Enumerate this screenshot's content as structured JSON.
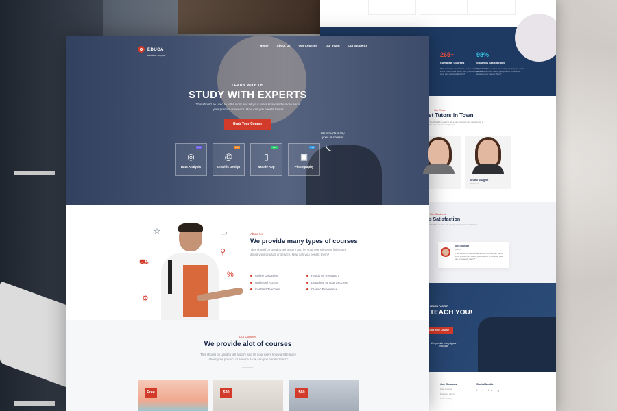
{
  "back_page": {
    "cards": [
      "",
      "",
      ""
    ],
    "stats": [
      {
        "value": "265+",
        "label": "Complete Courses",
        "text": "This should be used to tell a story and let your users know a little more about your product or service. How can you benefit them?",
        "color": "#f0513c"
      },
      {
        "value": "98%",
        "label": "Students Satisfaction",
        "text": "This should be used to tell a story and let your users know a little more about your product or service. How can you benefit them?",
        "color": "#38c4e8"
      }
    ],
    "tutors": {
      "tag": "Our Team",
      "heading": "st Tutors in Town",
      "text": "This should be used to tell a story and let your users know a little more about your product",
      "people": [
        {
          "name": "...nson",
          "role": ""
        },
        {
          "name": "Bruno Vaughn",
          "role": "Professor"
        }
      ]
    },
    "testimonial": {
      "tag": "Our Students",
      "heading": "nts Satisfaction",
      "text": "This should be used to tell a story and let your users know",
      "name": "Vera Duncan",
      "role": "Student",
      "quote": "“This should be used to tell a story and let your users know a little more about your product or service. How can you benefit them?”"
    },
    "cta": {
      "small": "LEARN FASTER",
      "big": "N TEACH YOU!",
      "button": "Grab Your Course",
      "note": "We provide many types of course"
    },
    "footer": {
      "col1_title": "Our Courses",
      "col1_items": [
        "Data Analysis",
        "Business Learn",
        "IT Consulting"
      ],
      "col2_title": "Social Media",
      "col2_icons": "f  t  in  g"
    }
  },
  "front_page": {
    "logo": {
      "name": "EDUCA",
      "sub": "Education Template"
    },
    "nav": [
      "Home",
      "About Us",
      "Our Courses",
      "Our Team",
      "Our Students"
    ],
    "hero": {
      "kicker": "LEARN WITH US",
      "title": "STUDY WITH EXPERTS",
      "desc": "This should be used to tell a story and let your users know a little more about your product or service. How can you benefit them?",
      "button": "Grab Your Course",
      "handwritten": "We provide many types of courses"
    },
    "categories": [
      {
        "label": "Data Analysis",
        "badge": "+18",
        "badge_color": "#6c5ce7",
        "icon": "globe-icon",
        "glyph": "◎"
      },
      {
        "label": "Graphic Design",
        "badge": "+16",
        "badge_color": "#f08a24",
        "icon": "fingerprint-icon",
        "glyph": "@"
      },
      {
        "label": "Mobile App",
        "badge": "+12",
        "badge_color": "#2ecc71",
        "icon": "smartphone-icon",
        "glyph": "▯"
      },
      {
        "label": "Photography",
        "badge": "+14",
        "badge_color": "#3498db",
        "icon": "camera-icon",
        "glyph": "▣"
      }
    ],
    "about": {
      "tag": "About Us",
      "heading": "We provide many types of courses",
      "text": "This should be used to tell a story and let your users know a little more about your product or service. How can you benefit them?",
      "features_left": [
        "Online Discipline",
        "Unlimited Access",
        "Certified Teachers"
      ],
      "features_right": [
        "Hands on Research",
        "Detached to Your Success",
        "Classic Experience"
      ]
    },
    "courses": {
      "tag": "Our Courses",
      "heading": "We provide alot of courses",
      "text": "This should be used to tell a story and let your users know a little more about your product or service. How can you benefit them?",
      "cards": [
        {
          "price": "Free",
          "bg": "linear-gradient(180deg,#f4c9b8,#f0a990 60%,#7fd0e5)"
        },
        {
          "price": "$30",
          "bg": "linear-gradient(180deg,#e9e4de,#d4cfc8)"
        },
        {
          "price": "$60",
          "bg": "linear-gradient(180deg,#c8ced6,#9fa8b5)"
        }
      ]
    }
  },
  "colors": {
    "accent": "#d23a2a",
    "navy": "#1b2a4a",
    "hero_overlay": "#30446e"
  }
}
